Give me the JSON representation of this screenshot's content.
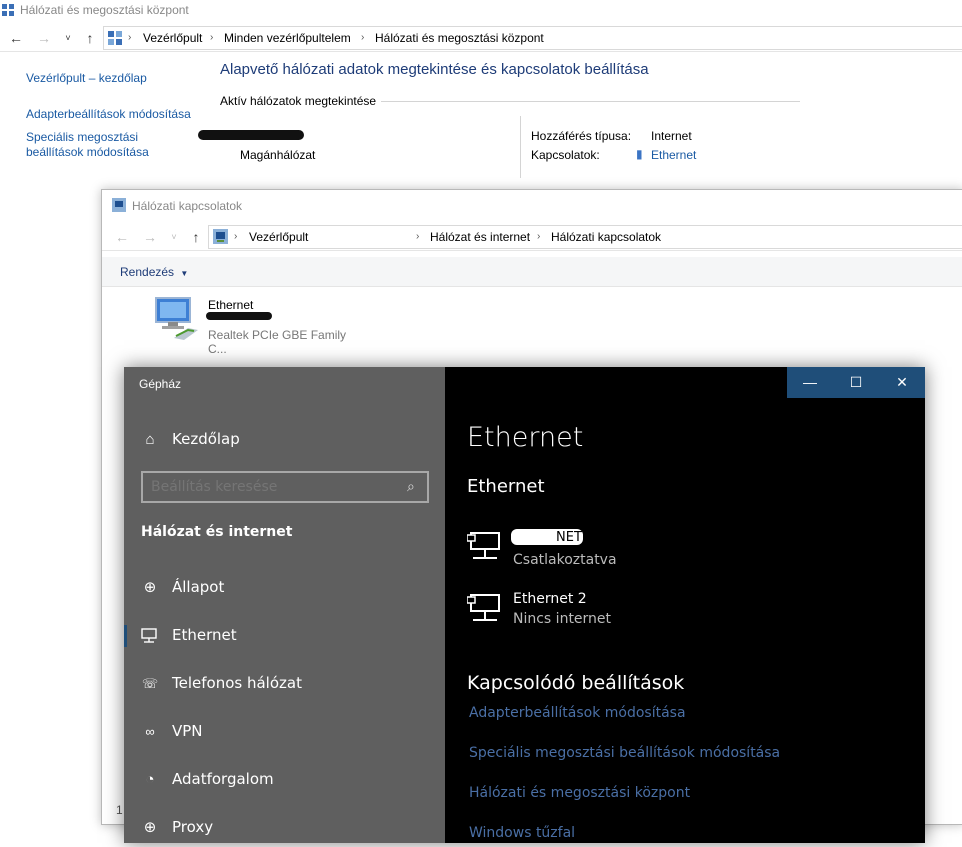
{
  "window1": {
    "title": "Hálózati és megosztási központ",
    "breadcrumb": [
      "Vezérlőpult",
      "Minden vezérlőpultelem",
      "Hálózati és megosztási központ"
    ],
    "sidebar": {
      "home_link": "Vezérlőpult – kezdőlap",
      "adapter_link": "Adapterbeállítások módosítása",
      "sharing_link_line1": "Speciális megosztási",
      "sharing_link_line2": "beállítások módosítása"
    },
    "heading": "Alapvető hálózati adatok megtekintése és kapcsolatok beállítása",
    "active_networks_label": "Aktív hálózatok megtekintése",
    "network_type": "Magánhálózat",
    "access_type_label": "Hozzáférés típusa:",
    "access_type_value": "Internet",
    "connections_label": "Kapcsolatok:",
    "connections_value": "Ethernet"
  },
  "window2": {
    "title": "Hálózati kapcsolatok",
    "breadcrumb": [
      "Vezérlőpult",
      "Hálózat és internet",
      "Hálózati kapcsolatok"
    ],
    "organize_label": "Rendezés",
    "adapter": {
      "name": "Ethernet",
      "device": "Realtek PCIe GBE Family C..."
    },
    "status_fragment": "1"
  },
  "window3": {
    "app_title": "Gépház",
    "home_label": "Kezdőlap",
    "search_placeholder": "Beállítás keresése",
    "category_title": "Hálózat és internet",
    "nav_items": [
      {
        "label": "Állapot",
        "icon": "globe-icon"
      },
      {
        "label": "Ethernet",
        "icon": "ethernet-icon"
      },
      {
        "label": "Telefonos hálózat",
        "icon": "dialup-icon"
      },
      {
        "label": "VPN",
        "icon": "vpn-icon"
      },
      {
        "label": "Adatforgalom",
        "icon": "data-usage-icon"
      },
      {
        "label": "Proxy",
        "icon": "proxy-icon"
      }
    ],
    "page_title": "Ethernet",
    "section_title": "Ethernet",
    "networks": [
      {
        "name": "NET",
        "status": "Csatlakoztatva"
      },
      {
        "name": "Ethernet 2",
        "status": "Nincs internet"
      }
    ],
    "related_title": "Kapcsolódó beállítások",
    "related_links": [
      "Adapterbeállítások módosítása",
      "Speciális megosztási beállítások módosítása",
      "Hálózati és megosztási központ",
      "Windows tűzfal"
    ],
    "window_buttons": {
      "minimize": "—",
      "maximize": "☐",
      "close": "✕"
    }
  },
  "colors": {
    "link_blue": "#1a5aa3",
    "heading_blue": "#1e3c78",
    "settings_sidebar": "#5f5f5f",
    "settings_accent": "#1f4e79",
    "settings_link": "#4a6fa5"
  }
}
